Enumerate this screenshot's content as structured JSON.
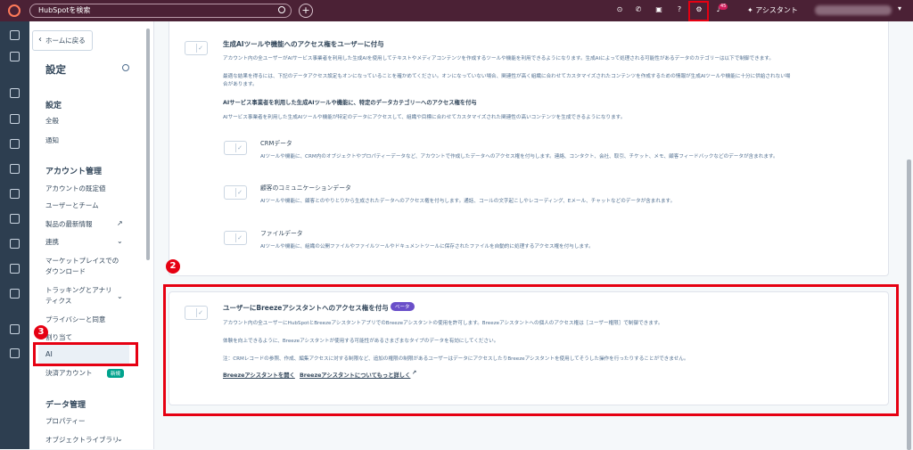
{
  "topbar": {
    "search_placeholder": "HubSpotを検索",
    "plus": "+",
    "badge_count": "45",
    "assistant_label": "アシスタント",
    "assistant_star": "✦",
    "caret": "▾"
  },
  "callouts": {
    "one": "1",
    "two": "2",
    "three": "3"
  },
  "sidebar": {
    "back_label": "ホームに戻る",
    "title": "設定",
    "section_settings": "設定",
    "item_general": "全般",
    "item_notify": "通知",
    "section_account": "アカウント管理",
    "item_default": "アカウントの既定値",
    "item_users": "ユーザーとチーム",
    "item_product": "製品の最新情報",
    "item_integration": "連携",
    "item_marketplace_1": "マーケットプレイスでの",
    "item_marketplace_2": "ダウンロード",
    "item_tracking_1": "トラッキングとアナリ",
    "item_tracking_2": "ティクス",
    "item_privacy": "プライバシーと同意",
    "item_assign": "割り当て",
    "item_ai": "AI",
    "item_payment": "決済アカウント",
    "new_badge": "新規",
    "section_data": "データ管理",
    "item_properties": "プロパティー",
    "item_objects": "オブジェクトライブラリ"
  },
  "card1": {
    "heading": "生成AIツールや機能へのアクセス権をユーザーに付与",
    "desc1": "アカウント内の全ユーザーがAIサービス事業者を利用した生成AIを使用してテキストやメディアコンテンツを作成するツールや機能を利用できるようになります。生成AIによって処理される可能性があるデータのカテゴリーは以下で制御できます。",
    "desc2a": "最適な結果を得るには、下記のデータアクセス設定もオンになっていることを確かめてください。オンになっていない場合、関連性が高く組織に合わせてカスタマイズされたコンテンツを作成するための情報が生成AIツールや機能に十分に供給されない場",
    "desc2b": "合があります。",
    "sub_heading": "AIサービス事業者を利用した生成AIツールや機能に、特定のデータカテゴリーへのアクセス権を付与",
    "sub_desc": "AIサービス事業者を利用した生成AIツールや機能が特定のデータにアクセスして、組織や目標に合わせてカスタマイズされた関連性の高いコンテンツを生成できるようになります。",
    "crm_title": "CRMデータ",
    "crm_desc": "AIツールや機能に、CRM内のオブジェクトやプロパティーデータなど、アカウントで作成したデータへのアクセス権を付与します。連絡、コンタクト、会社、取引、チケット、メモ、顧客フィードバックなどのデータが含まれます。",
    "comm_title": "顧客のコミュニケーションデータ",
    "comm_desc": "AIツールや機能に、顧客とのやりとりから生成されたデータへのアクセス権を付与します。通話、コールの文字起こしやレコーディング、Eメール、チャットなどのデータが含まれます。",
    "file_title": "ファイルデータ",
    "file_desc": "AIツールや機能に、組織の公開ファイルやファイルツールやドキュメントツールに保存されたファイルを自動的に処理するアクセス権を付与します。"
  },
  "card2": {
    "heading": "ユーザーにBreezeアシスタントへのアクセス権を付与",
    "beta": "ベータ",
    "desc1": "アカウント内の全ユーザーにHubSpotとBreezeアシスタントアプリでのBreezeアシスタントの使用を許可します。Breezeアシスタントへの個人のアクセス権は［ユーザー権限］で制御できます。",
    "desc2": "体験を向上できるように、Breezeアシスタントが使用する可能性があるさまざまなタイプのデータを有効にしてください。",
    "desc3": "注：CRMレコードの参照、作成、編集アクセスに対する制限など、追加の権限の制限があるユーザーはデータにアクセスしたりBreezeアシスタントを使用してそうした操作を行ったりすることができません。",
    "link1": "Breezeアシスタントを開く",
    "link2": "Breezeアシスタントについてもっと詳しく"
  }
}
